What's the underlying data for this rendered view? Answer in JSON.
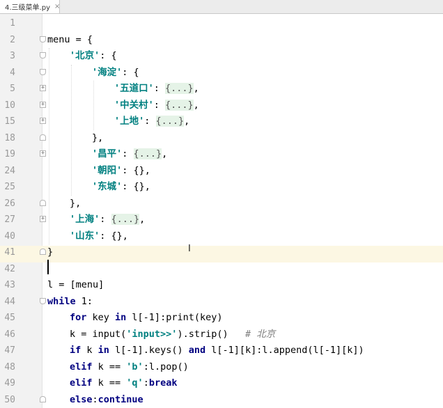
{
  "tab": {
    "filename": "4.三级菜单.py",
    "close": "×"
  },
  "lines": [
    {
      "n": "1",
      "fold": "",
      "indent": 0,
      "tokens": []
    },
    {
      "n": "2",
      "fold": "start",
      "indent": 0,
      "tokens": [
        [
          "t",
          "menu = {"
        ]
      ]
    },
    {
      "n": "3",
      "fold": "start",
      "indent": 1,
      "tokens": [
        [
          "s",
          "'北京'"
        ],
        [
          "t",
          ": {"
        ]
      ]
    },
    {
      "n": "4",
      "fold": "start",
      "indent": 2,
      "tokens": [
        [
          "s",
          "'海淀'"
        ],
        [
          "t",
          ": {"
        ]
      ]
    },
    {
      "n": "5",
      "fold": "plus",
      "indent": 3,
      "tokens": [
        [
          "s",
          "'五道口'"
        ],
        [
          "t",
          ": "
        ],
        [
          "f",
          "{...}"
        ],
        [
          "t",
          ","
        ]
      ]
    },
    {
      "n": "10",
      "fold": "plus",
      "indent": 3,
      "tokens": [
        [
          "s",
          "'中关村'"
        ],
        [
          "t",
          ": "
        ],
        [
          "f",
          "{...}"
        ],
        [
          "t",
          ","
        ]
      ]
    },
    {
      "n": "15",
      "fold": "plus",
      "indent": 3,
      "tokens": [
        [
          "s",
          "'上地'"
        ],
        [
          "t",
          ": "
        ],
        [
          "f",
          "{...}"
        ],
        [
          "t",
          ","
        ]
      ]
    },
    {
      "n": "18",
      "fold": "end",
      "indent": 2,
      "tokens": [
        [
          "t",
          "},"
        ]
      ]
    },
    {
      "n": "19",
      "fold": "plus",
      "indent": 2,
      "tokens": [
        [
          "s",
          "'昌平'"
        ],
        [
          "t",
          ": "
        ],
        [
          "f",
          "{...}"
        ],
        [
          "t",
          ","
        ]
      ]
    },
    {
      "n": "24",
      "fold": "",
      "indent": 2,
      "tokens": [
        [
          "s",
          "'朝阳'"
        ],
        [
          "t",
          ": {},"
        ]
      ]
    },
    {
      "n": "25",
      "fold": "",
      "indent": 2,
      "tokens": [
        [
          "s",
          "'东城'"
        ],
        [
          "t",
          ": {},"
        ]
      ]
    },
    {
      "n": "26",
      "fold": "end",
      "indent": 1,
      "tokens": [
        [
          "t",
          "},"
        ]
      ]
    },
    {
      "n": "27",
      "fold": "plus",
      "indent": 1,
      "tokens": [
        [
          "s",
          "'上海'"
        ],
        [
          "t",
          ": "
        ],
        [
          "f",
          "{...}"
        ],
        [
          "t",
          ","
        ]
      ]
    },
    {
      "n": "40",
      "fold": "",
      "indent": 1,
      "tokens": [
        [
          "s",
          "'山东'"
        ],
        [
          "t",
          ": {},"
        ]
      ]
    },
    {
      "n": "41",
      "fold": "end",
      "indent": 0,
      "tokens": [
        [
          "t",
          "}"
        ]
      ]
    },
    {
      "n": "42",
      "fold": "",
      "indent": 0,
      "tokens": []
    },
    {
      "n": "43",
      "fold": "",
      "indent": 0,
      "tokens": [
        [
          "t",
          "l = [menu]"
        ]
      ]
    },
    {
      "n": "44",
      "fold": "start",
      "indent": 0,
      "tokens": [
        [
          "k",
          "while"
        ],
        [
          "t",
          " 1:"
        ]
      ]
    },
    {
      "n": "45",
      "fold": "",
      "indent": 1,
      "tokens": [
        [
          "k",
          "for"
        ],
        [
          "t",
          " key "
        ],
        [
          "k",
          "in"
        ],
        [
          "t",
          " l[-1]:print(key)"
        ]
      ]
    },
    {
      "n": "46",
      "fold": "",
      "indent": 1,
      "tokens": [
        [
          "t",
          "k = input("
        ],
        [
          "s",
          "'input>>'"
        ],
        [
          "t",
          ").strip()   "
        ],
        [
          "c",
          "# 北京"
        ]
      ]
    },
    {
      "n": "47",
      "fold": "",
      "indent": 1,
      "tokens": [
        [
          "k",
          "if"
        ],
        [
          "t",
          " k "
        ],
        [
          "k",
          "in"
        ],
        [
          "t",
          " l[-1].keys() "
        ],
        [
          "k",
          "and"
        ],
        [
          "t",
          " l[-1][k]:l.append(l[-1][k])"
        ]
      ]
    },
    {
      "n": "48",
      "fold": "",
      "indent": 1,
      "tokens": [
        [
          "k",
          "elif"
        ],
        [
          "t",
          " k == "
        ],
        [
          "s",
          "'b'"
        ],
        [
          "t",
          ":l.pop()"
        ]
      ]
    },
    {
      "n": "49",
      "fold": "",
      "indent": 1,
      "tokens": [
        [
          "k",
          "elif"
        ],
        [
          "t",
          " k == "
        ],
        [
          "s",
          "'q'"
        ],
        [
          "t",
          ":"
        ],
        [
          "k",
          "break"
        ]
      ]
    },
    {
      "n": "50",
      "fold": "end",
      "indent": 1,
      "tokens": [
        [
          "k",
          "else"
        ],
        [
          "t",
          ":"
        ],
        [
          "k",
          "continue"
        ]
      ]
    }
  ]
}
